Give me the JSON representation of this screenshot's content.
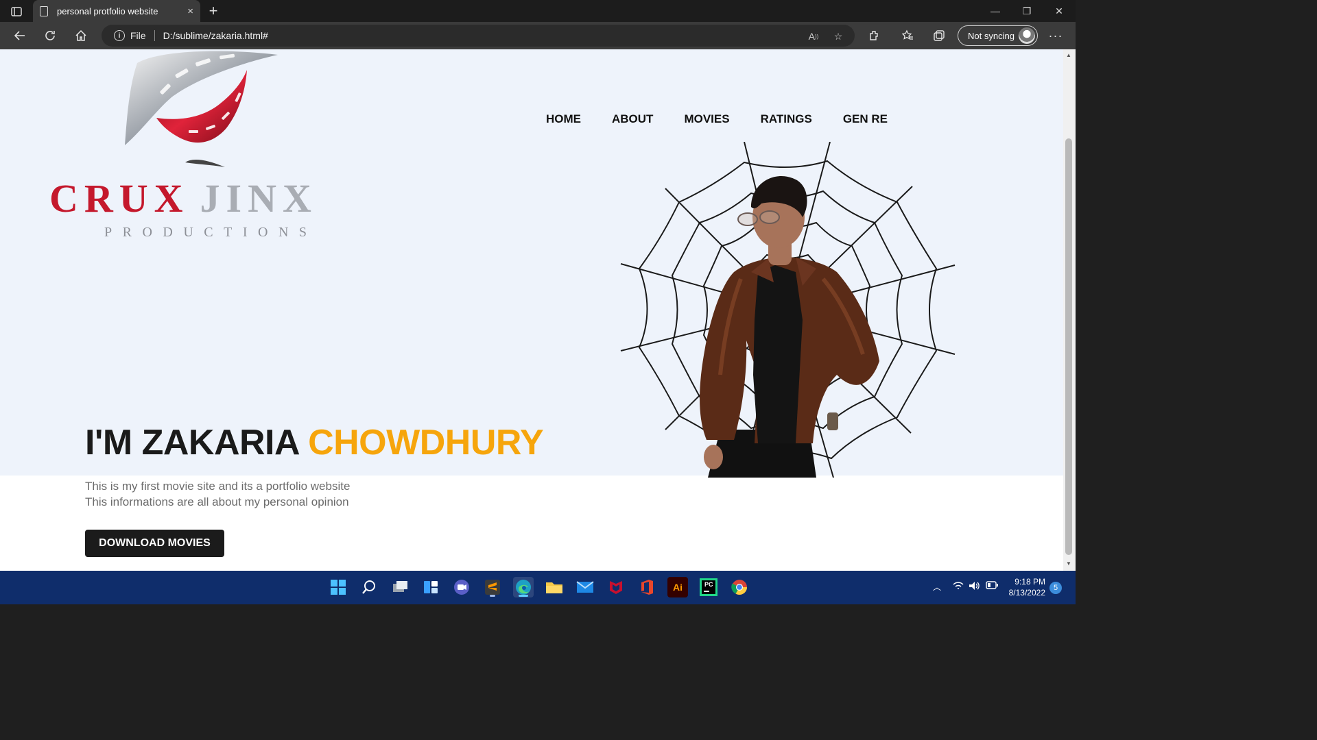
{
  "browser": {
    "tab_title": "personal protfolio website",
    "tab_close": "×",
    "new_tab": "+",
    "url_scheme": "File",
    "url": "D:/sublime/zakaria.html#",
    "sync_label": "Not syncing",
    "minimize": "—",
    "restore": "❐",
    "close": "✕"
  },
  "page": {
    "brand_primary": "CRUX",
    "brand_secondary": "JINX",
    "brand_sub": "PRODUCTIONS",
    "nav": [
      "HOME",
      "ABOUT",
      "MOVIES",
      "RATINGS",
      "GEN RE"
    ],
    "headline_prefix": "I'M ZAKARIA ",
    "headline_accent": "CHOWDHURY",
    "desc_line1": "This is my first movie site and its a portfolio website",
    "desc_line2": "This informations are all about my personal opinion",
    "download_button": "DOWNLOAD MOVIES",
    "colors": {
      "accent": "#f6a50c",
      "brand_red": "#c4182c",
      "hero_bg": "#eef3fb"
    }
  },
  "taskbar": {
    "apps": [
      "start-icon",
      "search-icon",
      "task-view-icon",
      "widgets-icon",
      "teams-icon",
      "sublime-text-icon",
      "edge-icon",
      "file-explorer-icon",
      "mail-icon",
      "mcafee-icon",
      "office-icon",
      "illustrator-icon",
      "pycharm-icon",
      "chrome-icon"
    ],
    "illustrator_label": "Ai",
    "pycharm_label": "PC",
    "time": "9:18 PM",
    "date": "8/13/2022",
    "notification_count": "5"
  }
}
